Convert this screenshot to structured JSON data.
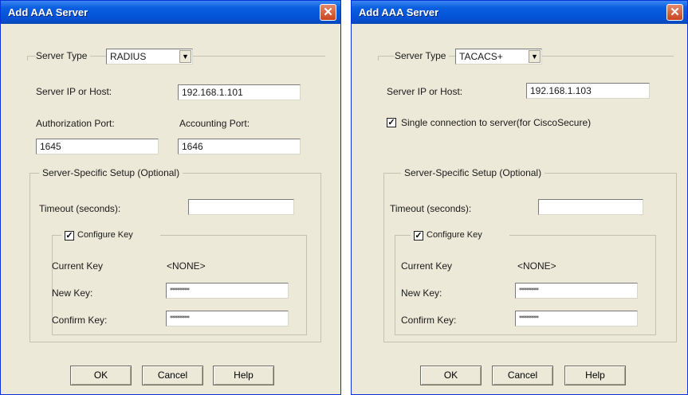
{
  "dialog1": {
    "title": "Add AAA Server",
    "server_type_label": "Server Type",
    "server_type_value": "RADIUS",
    "server_ip_label": "Server IP or Host:",
    "server_ip_value": "192.168.1.101",
    "auth_port_label": "Authorization Port:",
    "auth_port_value": "1645",
    "acct_port_label": "Accounting Port:",
    "acct_port_value": "1646",
    "specific_setup_label": "Server-Specific Setup (Optional)",
    "timeout_label": "Timeout (seconds):",
    "timeout_value": "",
    "configure_key_label": "Configure Key",
    "current_key_label": "Current Key",
    "current_key_value": "<NONE>",
    "new_key_label": "New Key:",
    "new_key_value": "********",
    "confirm_key_label": "Confirm Key:",
    "confirm_key_value": "********",
    "ok_label": "OK",
    "cancel_label": "Cancel",
    "help_label": "Help"
  },
  "dialog2": {
    "title": "Add AAA Server",
    "server_type_label": "Server Type",
    "server_type_value": "TACACS+",
    "server_ip_label": "Server IP or Host:",
    "server_ip_value": "192.168.1.103",
    "single_conn_label": "Single connection to server(for CiscoSecure)",
    "specific_setup_label": "Server-Specific Setup (Optional)",
    "timeout_label": "Timeout (seconds):",
    "timeout_value": "",
    "configure_key_label": "Configure Key",
    "current_key_label": "Current Key",
    "current_key_value": "<NONE>",
    "new_key_label": "New Key:",
    "new_key_value": "********",
    "confirm_key_label": "Confirm Key:",
    "confirm_key_value": "********",
    "ok_label": "OK",
    "cancel_label": "Cancel",
    "help_label": "Help"
  },
  "colors": {
    "titlebar": "#0a5fe0",
    "window_bg": "#ece9d8",
    "close_button": "#c9431f"
  },
  "icons": {
    "close": "close-icon",
    "dropdown": "chevron-down-icon",
    "check": "checkmark-icon"
  }
}
